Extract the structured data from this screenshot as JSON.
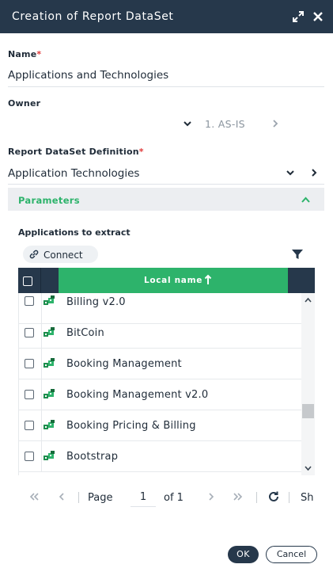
{
  "dialog": {
    "title": "Creation of Report DataSet",
    "icons": [
      "expand-icon",
      "close-icon"
    ]
  },
  "name_field": {
    "label": "Name",
    "required_mark": "*",
    "value": "Applications and Technologies"
  },
  "owner_field": {
    "label": "Owner",
    "value": "1. AS-IS"
  },
  "definition_field": {
    "label": "Report DataSet Definition",
    "required_mark": "*",
    "value": "Application Technologies"
  },
  "parameters": {
    "title": "Parameters",
    "expanded": true
  },
  "apps_section": {
    "label": "Applications to extract",
    "connect_label": "Connect"
  },
  "grid": {
    "column_header": "Local name",
    "sort": "ascending",
    "rows": [
      {
        "name": "Billing v2.0"
      },
      {
        "name": "BitCoin"
      },
      {
        "name": "Booking Management"
      },
      {
        "name": "Booking Management v2.0"
      },
      {
        "name": "Booking Pricing & Billing"
      },
      {
        "name": "Bootstrap"
      }
    ]
  },
  "pager": {
    "page_label": "Page",
    "page_value": "1",
    "of_label": "of 1",
    "show_label": "Sh"
  },
  "buttons": {
    "ok": "OK",
    "cancel": "Cancel"
  },
  "colors": {
    "header_bg": "#26384b",
    "accent_green": "#2db36b",
    "required_red": "#e03a3a"
  }
}
